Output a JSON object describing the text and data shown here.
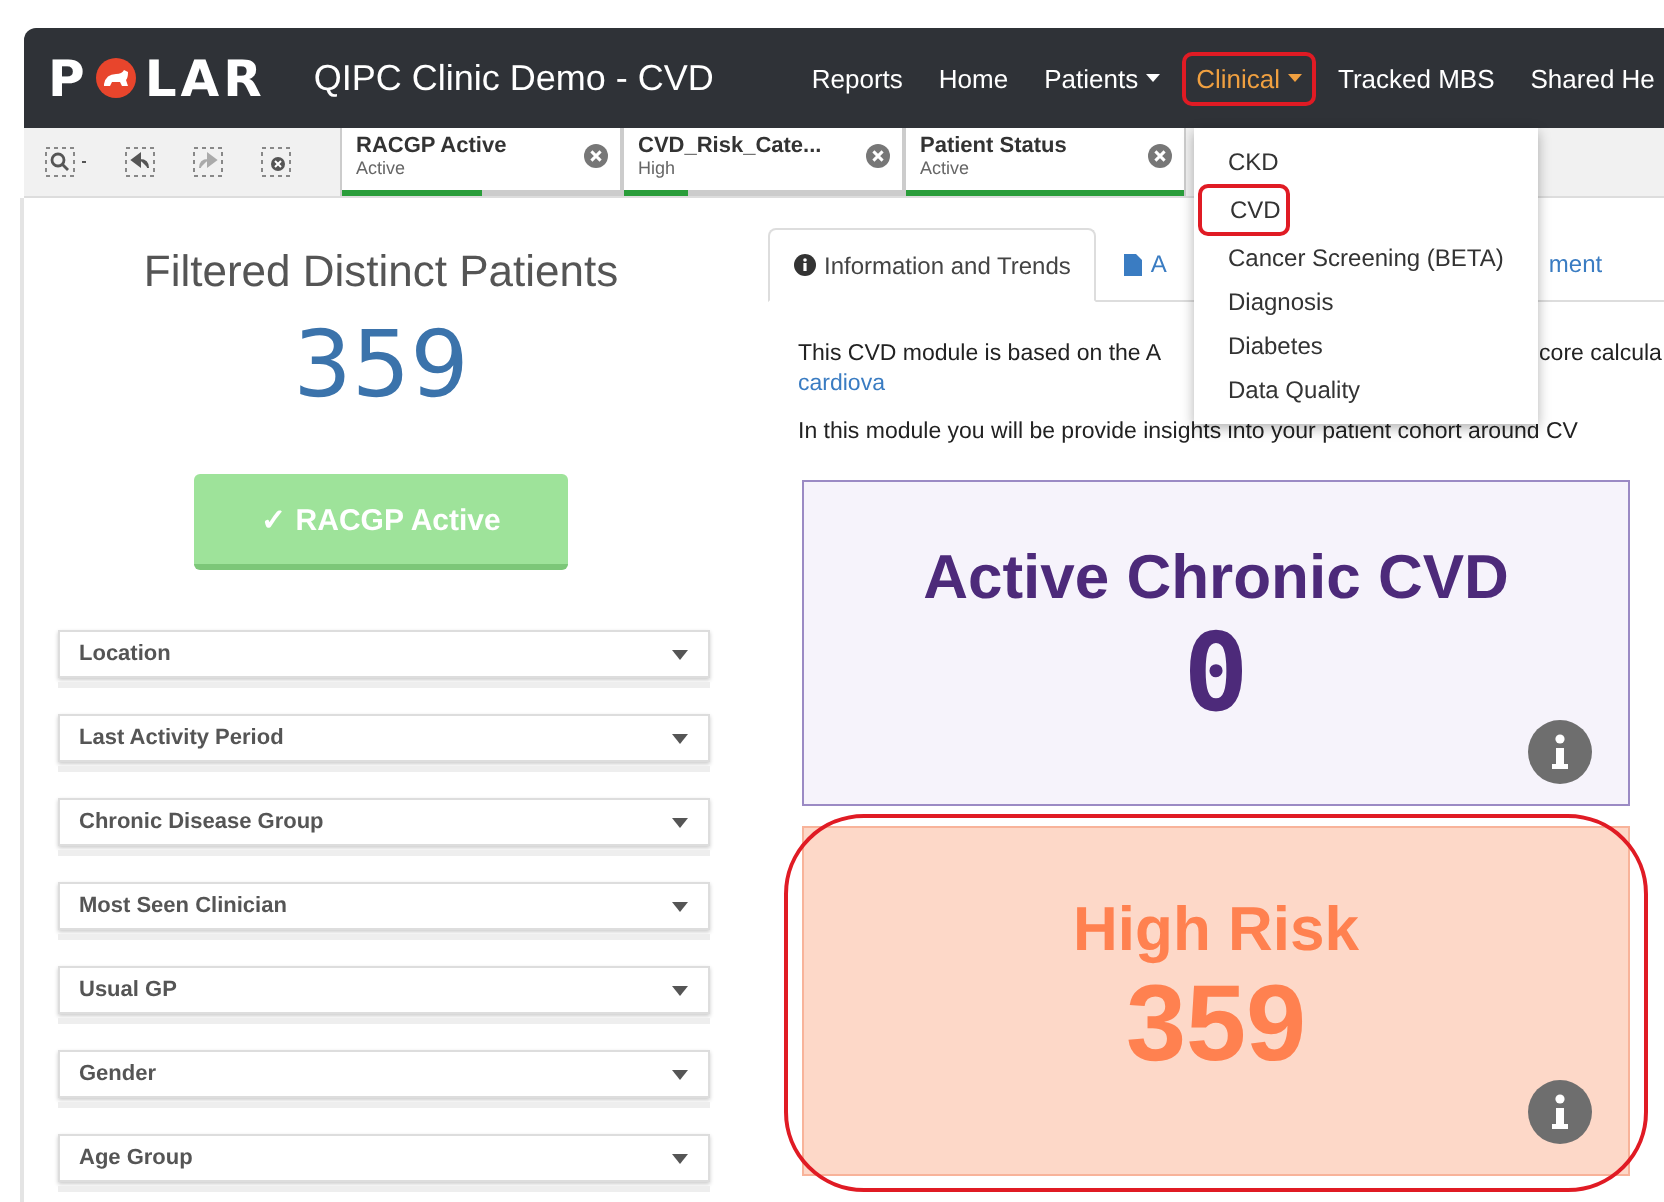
{
  "app": {
    "logo": "P",
    "logo_rest": "LAR",
    "title": "QIPC Clinic Demo - CVD"
  },
  "nav": [
    {
      "label": "Reports",
      "caret": false,
      "selected": false,
      "highlighted": false
    },
    {
      "label": "Home",
      "caret": false,
      "selected": false,
      "highlighted": false
    },
    {
      "label": "Patients",
      "caret": true,
      "selected": false,
      "highlighted": false
    },
    {
      "label": "Clinical",
      "caret": true,
      "selected": true,
      "highlighted": true
    },
    {
      "label": "Tracked MBS",
      "caret": false,
      "selected": false,
      "highlighted": false
    },
    {
      "label": "Shared He",
      "caret": false,
      "selected": false,
      "highlighted": false
    }
  ],
  "menu": [
    {
      "label": "CKD",
      "highlighted": false
    },
    {
      "label": "CVD",
      "highlighted": true
    },
    {
      "label": "Cancer Screening (BETA)",
      "highlighted": false
    },
    {
      "label": "Diagnosis",
      "highlighted": false
    },
    {
      "label": "Diabetes",
      "highlighted": false
    },
    {
      "label": "Data Quality",
      "highlighted": false
    }
  ],
  "toolbar": [
    {
      "kind": "zoom"
    },
    {
      "kind": "back"
    },
    {
      "kind": "forward"
    },
    {
      "kind": "clear"
    }
  ],
  "selections": [
    {
      "field": "RACGP Active",
      "value": "Active",
      "level": 0.5
    },
    {
      "field": "CVD_Risk_Cate...",
      "value": "High",
      "level": 0.23
    },
    {
      "field": "Patient Status",
      "value": "Active",
      "level": 1
    }
  ],
  "summary": {
    "title": "Filtered Distinct Patients",
    "count": "359",
    "button": "✓ RACGP Active"
  },
  "filters": [
    "Location",
    "Last Activity Period",
    "Chronic Disease Group",
    "Most Seen Clinician",
    "Usual GP",
    "Gender",
    "Age Group"
  ],
  "tabs": [
    {
      "label": "Information and Trends",
      "kind": "info",
      "selected": true
    },
    {
      "label": "A",
      "kind": "doc",
      "selected": false
    },
    {
      "label": "ment",
      "kind": "link",
      "selected": false
    }
  ],
  "intro": {
    "part_1": "This CVD module is based on the A",
    "part_2": "core calcula",
    "link": "cardiova",
    "line_2": "In this module you will be provide insights into your patient cohort around CV"
  },
  "cards": [
    {
      "title": "Active Chronic CVD",
      "value": "0",
      "kind": "purple",
      "highlighted": false
    },
    {
      "title": "High Risk",
      "value": "359",
      "kind": "orange",
      "highlighted": true
    }
  ]
}
